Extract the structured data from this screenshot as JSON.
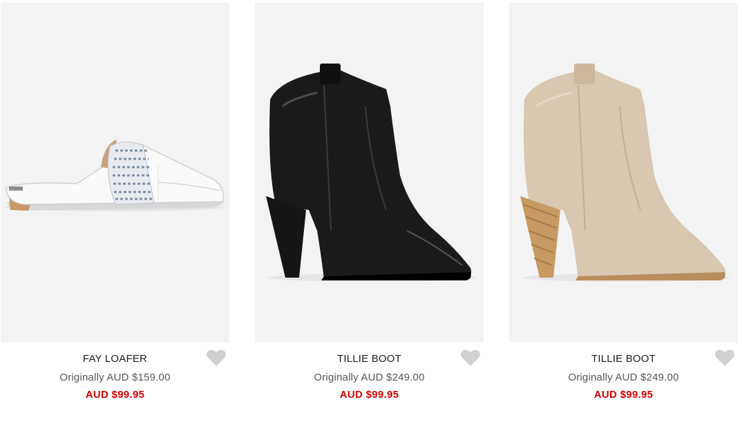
{
  "products": [
    {
      "name": "FAY LOAFER",
      "original_price": "Originally AUD $159.00",
      "sale_price": "AUD $99.95",
      "image_icon": "white-loafer-mule-image"
    },
    {
      "name": "TILLIE BOOT",
      "original_price": "Originally AUD $249.00",
      "sale_price": "AUD $99.95",
      "image_icon": "black-ankle-boot-image"
    },
    {
      "name": "TILLIE BOOT",
      "original_price": "Originally AUD $249.00",
      "sale_price": "AUD $99.95",
      "image_icon": "beige-suede-ankle-boot-image"
    }
  ],
  "wishlist_icon": "heart-icon",
  "colors": {
    "image_background": "#f3f3f3",
    "sale_price": "#d10000",
    "original_price": "#555555",
    "heart": "#d0d0d0"
  }
}
